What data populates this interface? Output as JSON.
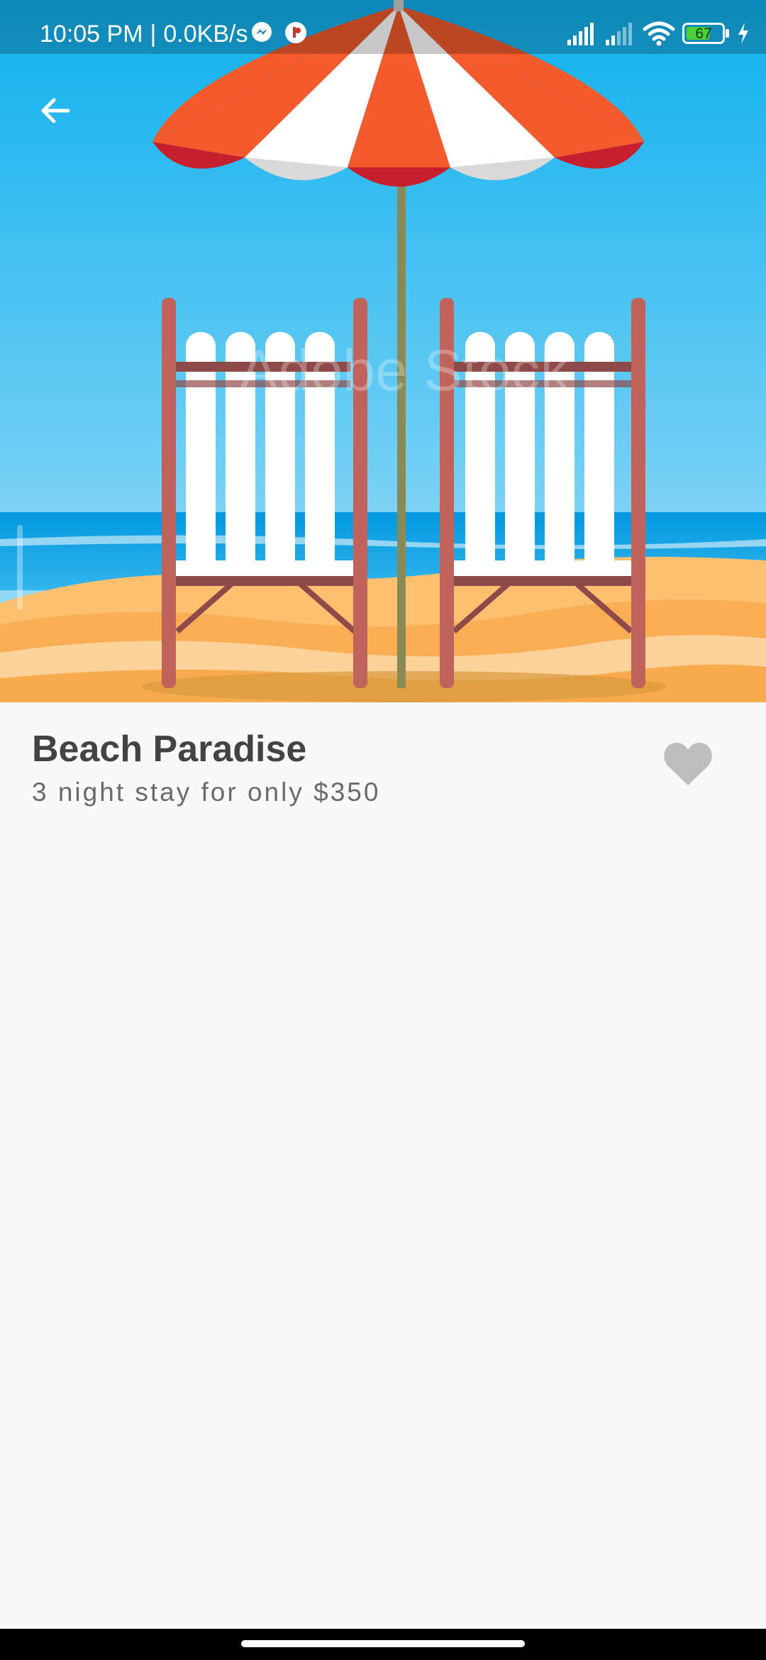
{
  "status_bar": {
    "time": "10:05 PM",
    "separator": "|",
    "network_speed": "0.0KB/s",
    "notification_icons": [
      "messenger-icon",
      "app-notification-icon"
    ],
    "system_icons": [
      "signal-icon",
      "signal-icon",
      "wifi-icon",
      "battery-icon",
      "charging-icon"
    ],
    "battery_level": "67"
  },
  "hero": {
    "watermark": "Adobe Stock",
    "colors": {
      "sky_top": "#10b2ee",
      "sky_bottom": "#9fdcf6",
      "sea": "#03a4e6",
      "sand": "#fbb968",
      "umbrella_red": "#f35a2c",
      "umbrella_white": "#ffffff"
    }
  },
  "nav": {
    "back_icon": "arrow-left-icon"
  },
  "detail": {
    "title": "Beach Paradise",
    "subtitle": "3 night stay for only $350",
    "favorite_icon": "heart-icon",
    "favorite_color": "#bdbdbd"
  },
  "system_nav": {
    "home_indicator": "home-indicator"
  }
}
